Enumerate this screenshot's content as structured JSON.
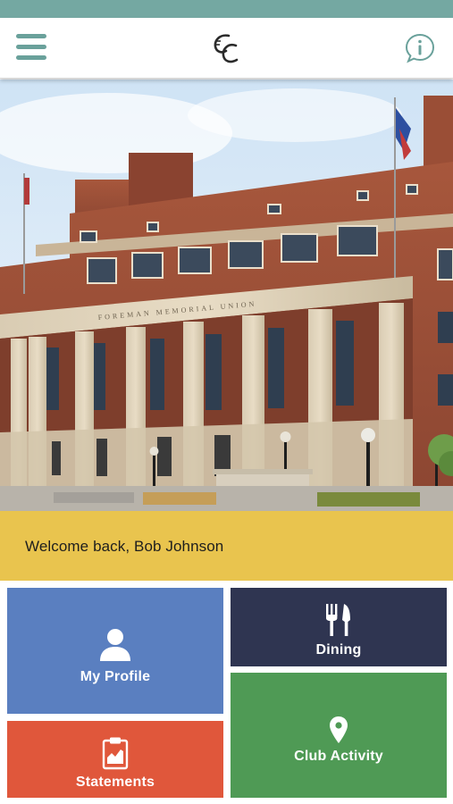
{
  "app_bar": {
    "menu_icon": "hamburger-menu-icon",
    "logo_icon": "club-logo-cc-icon",
    "info_icon": "info-bubble-icon"
  },
  "hero": {
    "image": "club building exterior photo",
    "building_inscription": "FOREMAN MEMORIAL UNION"
  },
  "welcome": {
    "text": "Welcome back, Bob Johnson"
  },
  "tiles": [
    {
      "label": "My Profile",
      "icon": "person-icon",
      "color": "#5a7fc0"
    },
    {
      "label": "Dining",
      "icon": "fork-knife-icon",
      "color": "#2f3551"
    },
    {
      "label": "Statements",
      "icon": "clipboard-chart-icon",
      "color": "#e0573b"
    },
    {
      "label": "Club Activity",
      "icon": "location-pin-icon",
      "color": "#4f9a55"
    }
  ],
  "colors": {
    "status_bar": "#74a8a2",
    "accent": "#6aa19b",
    "welcome_bar": "#e9c44e"
  }
}
